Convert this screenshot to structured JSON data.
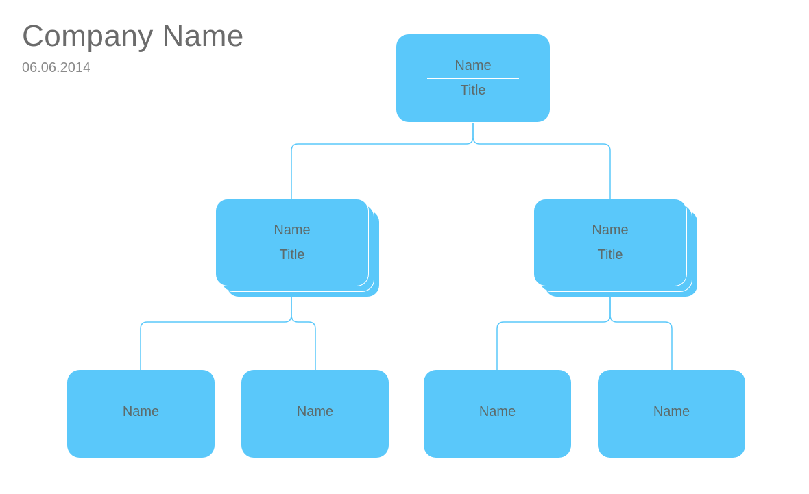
{
  "header": {
    "company_name": "Company Name",
    "date": "06.06.2014"
  },
  "nodes": {
    "root": {
      "name": "Name",
      "title": "Title"
    },
    "left_mgr": {
      "name": "Name",
      "title": "Title"
    },
    "right_mgr": {
      "name": "Name",
      "title": "Title"
    },
    "leaf1": {
      "name": "Name"
    },
    "leaf2": {
      "name": "Name"
    },
    "leaf3": {
      "name": "Name"
    },
    "leaf4": {
      "name": "Name"
    }
  },
  "colors": {
    "node_fill": "#5ac8fa",
    "text": "#5d6b6b",
    "header_text": "#6b6b6b"
  }
}
